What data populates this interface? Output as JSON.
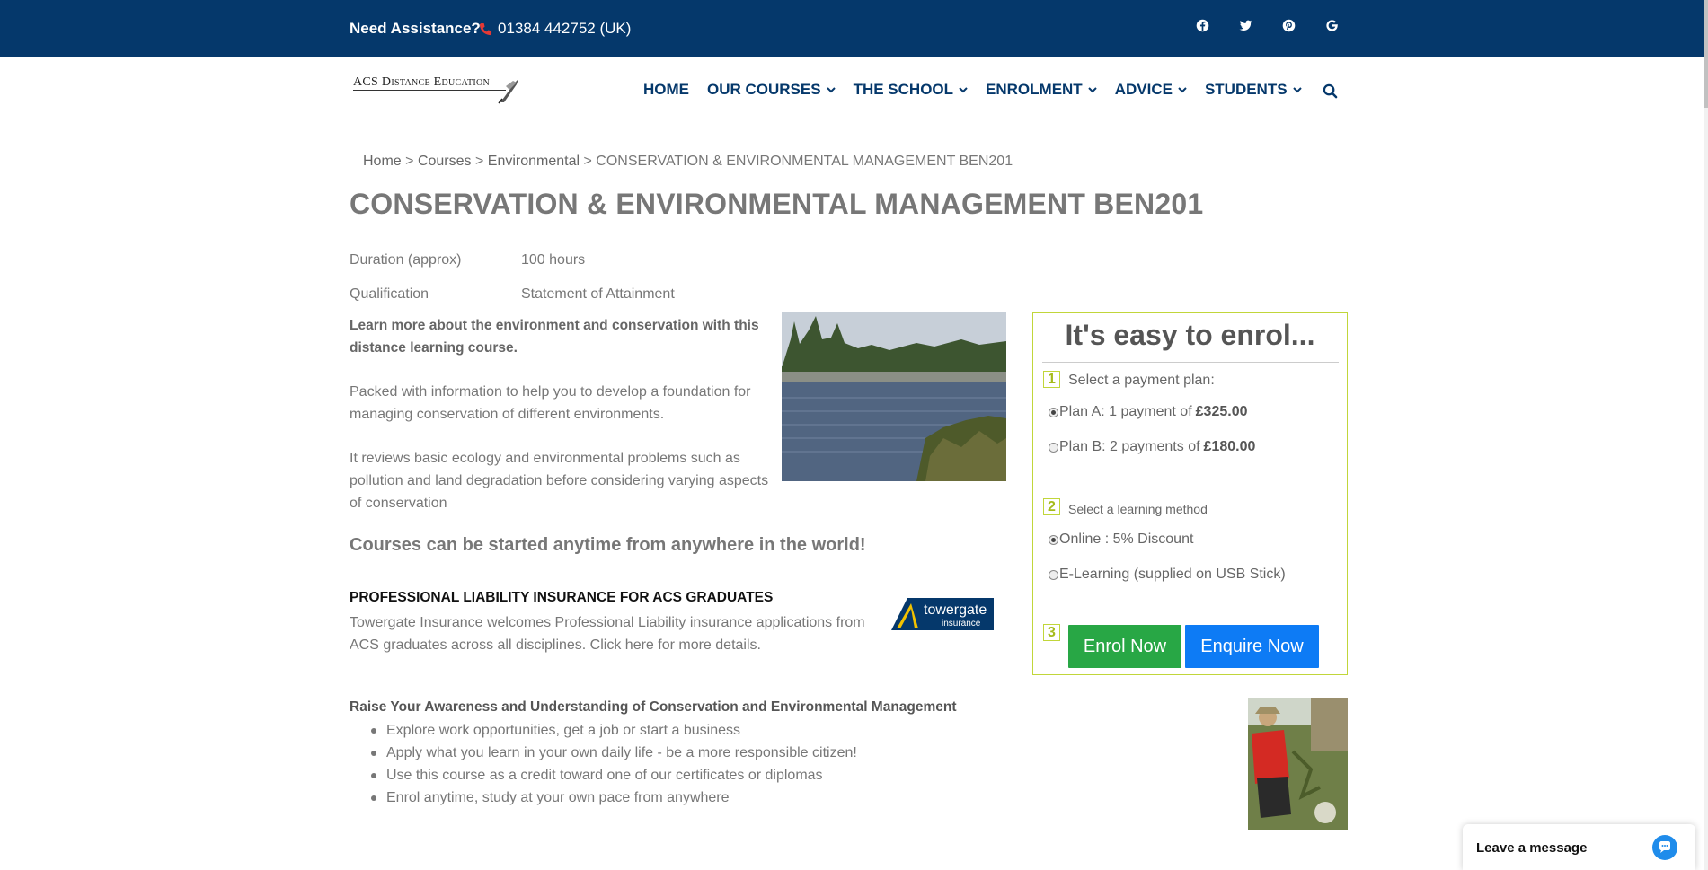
{
  "topbar": {
    "assist_label": "Need Assistance?",
    "phone": "01384 442752 (UK)",
    "socials": [
      "facebook-icon",
      "twitter-icon",
      "pinterest-icon",
      "google-icon"
    ]
  },
  "logo": {
    "text": "ACS Distance Education"
  },
  "nav": {
    "items": [
      {
        "label": "HOME",
        "dropdown": false
      },
      {
        "label": "OUR COURSES",
        "dropdown": true
      },
      {
        "label": "THE SCHOOL",
        "dropdown": true
      },
      {
        "label": "ENROLMENT",
        "dropdown": true
      },
      {
        "label": "ADVICE",
        "dropdown": true
      },
      {
        "label": "STUDENTS",
        "dropdown": true
      }
    ],
    "accent": "#05386b"
  },
  "breadcrumb": {
    "home": "Home",
    "courses": "Courses",
    "category": "Environmental",
    "separator": ">",
    "current": "CONSERVATION & ENVIRONMENTAL MANAGEMENT BEN201"
  },
  "page_title": "CONSERVATION & ENVIRONMENTAL MANAGEMENT BEN201",
  "meta": {
    "duration_label": "Duration (approx)",
    "duration_value": "100 hours",
    "qualification_label": "Qualification",
    "qualification_value": "Statement of Attainment"
  },
  "intro": {
    "bold": "Learn more about the environment and conservation with this distance learning course.",
    "p1": "Packed with information to help you to develop a foundation for managing conservation of different environments.",
    "p2": "It reviews basic ecology and environmental problems such as pollution and land degradation before considering varying aspects of conservation",
    "anytime": "Courses can be started anytime from anywhere in the world!"
  },
  "insurance": {
    "title": "PROFESSIONAL LIABILITY INSURANCE FOR ACS GRADUATES",
    "text": "Towergate Insurance welcomes Professional Liability insurance applications from ACS graduates across all disciplines. Click here for more details.",
    "logo_line1": "towergate",
    "logo_line2": "insurance"
  },
  "raise": {
    "title": "Raise Your Awareness and Understanding of Conservation and Environmental Management",
    "items": [
      "Explore work opportunities, get a job or start a business",
      "Apply what you learn in your own daily life - be a more responsible citizen!",
      "Use this course as a credit toward one of our certificates or diplomas",
      "Enrol anytime, study at your own pace from anywhere"
    ]
  },
  "enrol": {
    "title": "It's easy to enrol...",
    "step1_num": "1",
    "step1_label": "Select a payment plan:",
    "plan_a_text": "Plan A: 1 payment of",
    "plan_a_price": "£325.00",
    "plan_a_selected": true,
    "plan_b_text": "Plan B: 2 payments of",
    "plan_b_price": "£180.00",
    "plan_b_selected": false,
    "step2_num": "2",
    "step2_label": "Select a learning method",
    "method_online": "Online : 5% Discount",
    "method_online_selected": true,
    "method_elearning": "E-Learning (supplied on USB Stick)",
    "method_elearning_selected": false,
    "step3_num": "3",
    "enrol_button": "Enrol Now",
    "enquire_button": "Enquire Now",
    "border_color": "#c1d63a"
  },
  "chat": {
    "label": "Leave a message"
  }
}
